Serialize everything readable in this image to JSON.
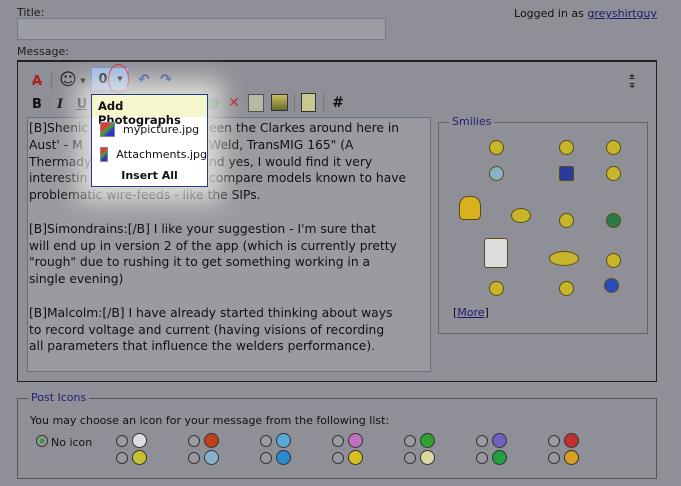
{
  "title_label": "Title:",
  "title_value": "",
  "logged_in_prefix": "Logged in as ",
  "username": "greyshirtguy",
  "message_label": "Message:",
  "toolbar": {
    "bold": "B",
    "italic": "I",
    "underline": "U",
    "hash": "#"
  },
  "attach_menu": {
    "header": "Add Photographs",
    "items": [
      "mypicture.jpg",
      "Attachments.jpg"
    ],
    "insert_all": "Insert All"
  },
  "message_lines": [
    [
      "[B]Shenic",
      "een the Clarkes around here in"
    ],
    [
      "Aust' - M",
      "Weld, TransMIG 165\" (A"
    ],
    [
      "Thermady",
      "nd yes, I would find it very"
    ],
    [
      "interestin",
      "compare models known to have"
    ],
    [
      "problematic wire-feeds - like the SIPs.",
      ""
    ],
    [
      "",
      ""
    ],
    [
      "[B]Simondrains:[/B] I like your suggestion - I'm sure that",
      ""
    ],
    [
      "will end up in version 2 of the app (which is currently pretty",
      ""
    ],
    [
      "\"rough\" due to rushing it to get something working in a",
      ""
    ],
    [
      "single evening)",
      ""
    ],
    [
      "",
      ""
    ],
    [
      "[B]Malcolm:[/B] I have already started thinking about ways",
      ""
    ],
    [
      "to record voltage and current (having visions of recording",
      ""
    ],
    [
      "all parameters that influence the welders performance).",
      ""
    ]
  ],
  "smilies": {
    "legend": "Smilies",
    "more": "More"
  },
  "post_icons": {
    "legend": "Post Icons",
    "instructions": "You may choose an icon for your message from the following list:",
    "no_icon": "No icon",
    "selected": "No icon",
    "row1_colors": [
      "#ddd",
      "#c0401a",
      "#5aaad8",
      "#c070c0",
      "#30a030",
      "#7060c0",
      "#c03030"
    ],
    "row2_colors": [
      "#c8c030",
      "#8ab0d0",
      "#2a8ad0",
      "#d8c020",
      "#d8d8a0",
      "#20a040",
      "#d8a020"
    ]
  }
}
